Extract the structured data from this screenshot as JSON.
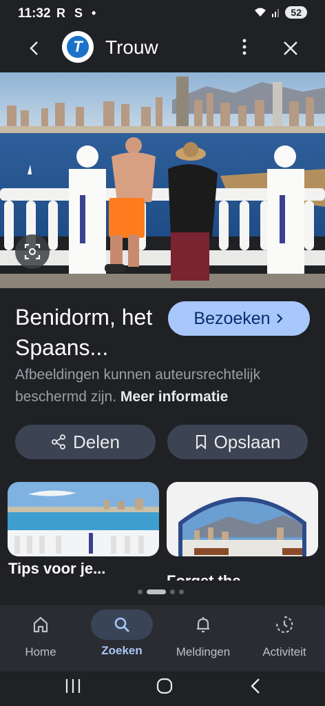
{
  "status": {
    "time": "11:32",
    "icons": "R S •",
    "battery": "52"
  },
  "appbar": {
    "title": "Trouw",
    "logo_letter": "T"
  },
  "hero": {
    "alt": ""
  },
  "result": {
    "headline": "Benidorm, het Spaans...",
    "visit_label": "Bezoeken",
    "copyright_text": "Afbeeldingen kunnen auteursrechtelijk beschermd zijn.",
    "more_info_label": "Meer informatie"
  },
  "actions": {
    "share_label": "Delen",
    "save_label": "Opslaan"
  },
  "related": [
    {
      "title": "Tips voor je..."
    },
    {
      "title": "Forget the"
    }
  ],
  "bottom_nav": {
    "items": [
      {
        "label": "Home",
        "icon": "home-icon"
      },
      {
        "label": "Zoeken",
        "icon": "search-icon"
      },
      {
        "label": "Meldingen",
        "icon": "bell-icon"
      },
      {
        "label": "Activiteit",
        "icon": "history-icon"
      }
    ],
    "active_color": "#a8c7fa"
  }
}
